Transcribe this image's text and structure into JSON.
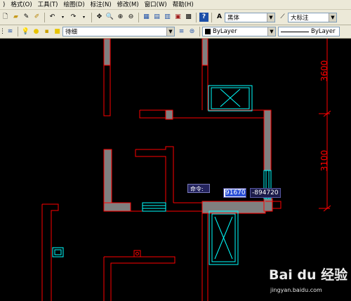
{
  "menu": {
    "items": [
      "格式(O)",
      "工具(T)",
      "绘图(D)",
      "标注(N)",
      "修改(M)",
      "窗口(W)",
      "帮助(H)"
    ],
    "leading": ")"
  },
  "toolbar1": {
    "font_combo": "黑体",
    "dimstyle_combo": "大标注"
  },
  "toolbar2": {
    "layer_combo": "待细",
    "color_combo": "ByLayer",
    "linetype_combo": "ByLayer"
  },
  "canvas": {
    "dim_top": "3600",
    "dim_bottom": "3100",
    "command_label": "命令:",
    "coord_x": "91670",
    "coord_y": "-894720"
  },
  "colors": {
    "wall_line": "#ff0000",
    "wall_fill": "#808080",
    "window": "#00ffff",
    "dimension": "#ff0000"
  },
  "watermark": {
    "logo": "Bai du 经验",
    "url": "jingyan.baidu.com"
  }
}
